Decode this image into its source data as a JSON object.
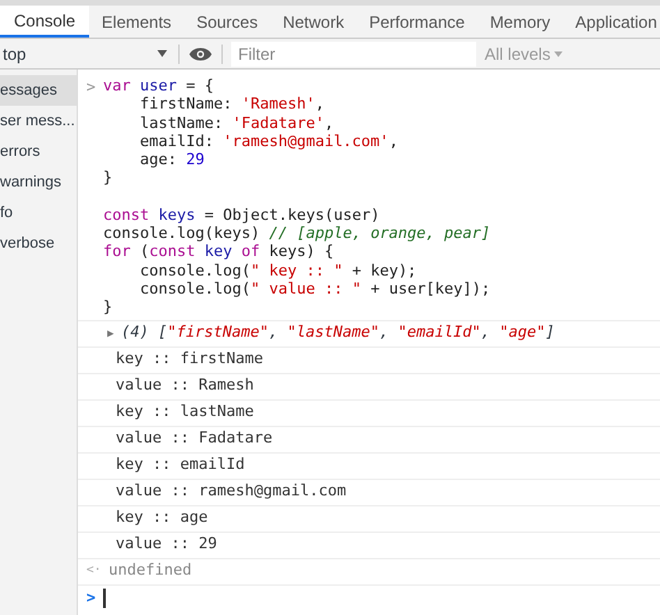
{
  "tabs": [
    {
      "label": "Console",
      "selected": true
    },
    {
      "label": "Elements",
      "selected": false
    },
    {
      "label": "Sources",
      "selected": false
    },
    {
      "label": "Network",
      "selected": false
    },
    {
      "label": "Performance",
      "selected": false
    },
    {
      "label": "Memory",
      "selected": false
    },
    {
      "label": "Application",
      "selected": false
    }
  ],
  "toolbar": {
    "context": "top",
    "filter_placeholder": "Filter",
    "levels": "All levels"
  },
  "sidebar": {
    "items": [
      {
        "label": "essages",
        "selected": true
      },
      {
        "label": "ser mess...",
        "selected": false
      },
      {
        "label": "errors",
        "selected": false
      },
      {
        "label": "warnings",
        "selected": false
      },
      {
        "label": "fo",
        "selected": false
      },
      {
        "label": "verbose",
        "selected": false
      }
    ]
  },
  "input": {
    "prompt": ">",
    "lines": [
      {
        "tokens": [
          {
            "kind": "kw",
            "text": "var"
          },
          {
            "kind": "name",
            "text": " user"
          },
          {
            "kind": "plain",
            "text": " = {"
          }
        ]
      },
      {
        "tokens": [
          {
            "kind": "plain",
            "text": "    firstName: "
          },
          {
            "kind": "str",
            "text": "'Ramesh'"
          },
          {
            "kind": "plain",
            "text": ","
          }
        ]
      },
      {
        "tokens": [
          {
            "kind": "plain",
            "text": "    lastName: "
          },
          {
            "kind": "str",
            "text": "'Fadatare'"
          },
          {
            "kind": "plain",
            "text": ","
          }
        ]
      },
      {
        "tokens": [
          {
            "kind": "plain",
            "text": "    emailId: "
          },
          {
            "kind": "str",
            "text": "'ramesh@gmail.com'"
          },
          {
            "kind": "plain",
            "text": ","
          }
        ]
      },
      {
        "tokens": [
          {
            "kind": "plain",
            "text": "    age: "
          },
          {
            "kind": "num",
            "text": "29"
          }
        ]
      },
      {
        "tokens": [
          {
            "kind": "plain",
            "text": "}"
          }
        ]
      },
      {
        "gap_before": true,
        "tokens": [
          {
            "kind": "kw",
            "text": "const"
          },
          {
            "kind": "name",
            "text": " keys"
          },
          {
            "kind": "plain",
            "text": " = Object.keys(user)"
          }
        ]
      },
      {
        "tokens": [
          {
            "kind": "plain",
            "text": "console.log(keys) "
          },
          {
            "kind": "comment",
            "text": "// [apple, orange, pear]"
          }
        ]
      },
      {
        "tokens": [
          {
            "kind": "kw",
            "text": "for"
          },
          {
            "kind": "plain",
            "text": " ("
          },
          {
            "kind": "kw",
            "text": "const"
          },
          {
            "kind": "name",
            "text": " key"
          },
          {
            "kind": "kw",
            "text": " of"
          },
          {
            "kind": "plain",
            "text": " keys) {"
          }
        ]
      },
      {
        "tokens": [
          {
            "kind": "plain",
            "text": "    console.log("
          },
          {
            "kind": "str",
            "text": "\" key :: \""
          },
          {
            "kind": "plain",
            "text": " + key);"
          }
        ]
      },
      {
        "tokens": [
          {
            "kind": "plain",
            "text": "    console.log("
          },
          {
            "kind": "str",
            "text": "\" value :: \""
          },
          {
            "kind": "plain",
            "text": " + user[key]);"
          }
        ]
      },
      {
        "tokens": [
          {
            "kind": "plain",
            "text": "}"
          }
        ]
      }
    ]
  },
  "array_output": {
    "expander": "▶",
    "tokens": [
      {
        "kind": "plain",
        "text": "(4) ["
      },
      {
        "kind": "str",
        "text": "\"firstName\""
      },
      {
        "kind": "plain",
        "text": ", "
      },
      {
        "kind": "str",
        "text": "\"lastName\""
      },
      {
        "kind": "plain",
        "text": ", "
      },
      {
        "kind": "str",
        "text": "\"emailId\""
      },
      {
        "kind": "plain",
        "text": ", "
      },
      {
        "kind": "str",
        "text": "\"age\""
      },
      {
        "kind": "plain",
        "text": "]"
      }
    ]
  },
  "log_lines": [
    "key :: firstName",
    "value :: Ramesh",
    "key :: lastName",
    "value :: Fadatare",
    "key :: emailId",
    "value :: ramesh@gmail.com",
    "key :: age",
    "value :: 29"
  ],
  "result": {
    "arrow": "<·",
    "text": "undefined"
  },
  "prompt": ">"
}
